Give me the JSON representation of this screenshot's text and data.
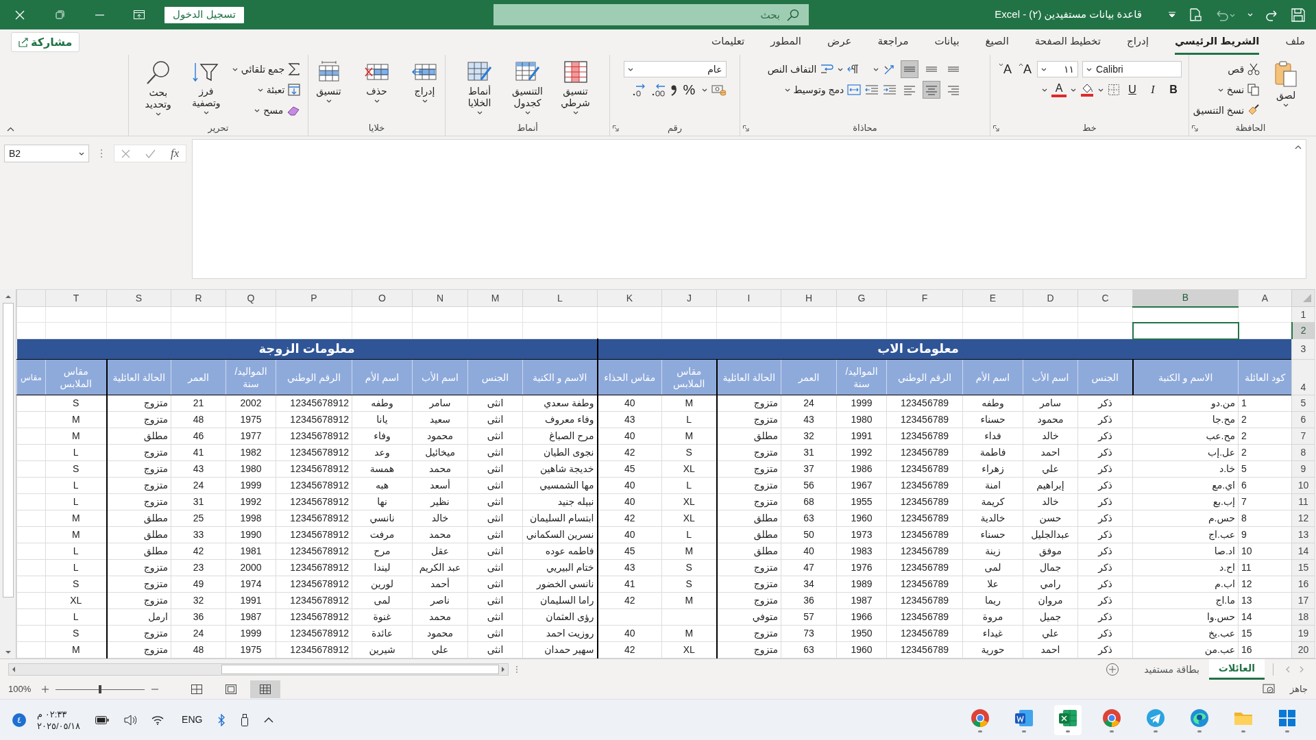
{
  "title_bar": {
    "title": "قاعدة بيانات مستفيدين (٢) - Excel",
    "search_placeholder": "بحث",
    "sign_in": "تسجيل الدخول"
  },
  "ribbon_tabs": [
    {
      "label": "ملف",
      "selected": false
    },
    {
      "label": "الشريط الرئيسي",
      "selected": true
    },
    {
      "label": "إدراج",
      "selected": false
    },
    {
      "label": "تخطيط الصفحة",
      "selected": false
    },
    {
      "label": "الصيغ",
      "selected": false
    },
    {
      "label": "بيانات",
      "selected": false
    },
    {
      "label": "مراجعة",
      "selected": false
    },
    {
      "label": "عرض",
      "selected": false
    },
    {
      "label": "المطور",
      "selected": false
    },
    {
      "label": "تعليمات",
      "selected": false
    }
  ],
  "share_button": "مشاركة",
  "ribbon_groups": [
    {
      "label": "الحافظة",
      "columns": [
        {
          "rows": [
            [
              {
                "kind": "paste",
                "label": "لصق"
              }
            ]
          ]
        },
        {
          "rows": [
            [
              {
                "kind": "cut",
                "label": "قص"
              }
            ],
            [
              {
                "kind": "copy",
                "label": "نسخ"
              }
            ],
            [
              {
                "kind": "painter",
                "label": "نسخ التنسيق"
              }
            ]
          ]
        }
      ]
    },
    {
      "label": "خط",
      "columns": [
        {
          "rows": [
            [
              {
                "kind": "font",
                "value": "Calibri"
              },
              {
                "kind": "size",
                "value": "١١"
              },
              {
                "kind": "grow",
                "label": "A"
              },
              {
                "kind": "shrink",
                "label": "A"
              }
            ],
            [
              {
                "kind": "bold",
                "label": "B"
              },
              {
                "kind": "italic",
                "label": "I"
              },
              {
                "kind": "underline",
                "label": "U"
              },
              {
                "kind": "borders"
              },
              {
                "kind": "fill"
              },
              {
                "kind": "fontcolor",
                "label": "A"
              }
            ]
          ]
        }
      ]
    },
    {
      "label": "محاذاة",
      "columns": [
        {
          "rows": [
            [
              {
                "kind": "valign",
                "selected": false
              },
              {
                "kind": "valign",
                "selected": false
              },
              {
                "kind": "valign",
                "selected": true
              },
              {
                "kind": "orientation"
              }
            ],
            [
              {
                "kind": "halign",
                "selected": false
              },
              {
                "kind": "halign",
                "selected": true
              },
              {
                "kind": "halign",
                "selected": false
              },
              {
                "kind": "indent"
              },
              {
                "kind": "outdent"
              }
            ]
          ]
        },
        {
          "rows": [
            [
              {
                "kind": "rtl"
              },
              {
                "kind": "wrap",
                "label": "التفاف النص"
              }
            ],
            [
              {
                "kind": "merge",
                "label": "دمج وتوسيط"
              }
            ]
          ]
        }
      ]
    },
    {
      "label": "رقم",
      "columns": [
        {
          "rows": [
            [
              {
                "kind": "format",
                "value": "عام"
              }
            ],
            [
              {
                "kind": "currency"
              },
              {
                "kind": "percent",
                "label": "%"
              },
              {
                "kind": "comma"
              },
              {
                "kind": "incdec"
              },
              {
                "kind": "decdec"
              }
            ]
          ]
        }
      ]
    },
    {
      "label": "أنماط",
      "columns": [
        {
          "rows": [
            [
              {
                "kind": "conditional",
                "label": "تنسيق شرطي"
              }
            ]
          ]
        },
        {
          "rows": [
            [
              {
                "kind": "astable",
                "label": "التنسيق كجدول"
              }
            ]
          ]
        },
        {
          "rows": [
            [
              {
                "kind": "styles",
                "label": "أنماط الخلايا"
              }
            ]
          ]
        }
      ]
    },
    {
      "label": "خلايا",
      "columns": [
        {
          "rows": [
            [
              {
                "kind": "insert",
                "label": "إدراج"
              }
            ]
          ]
        },
        {
          "rows": [
            [
              {
                "kind": "delete",
                "label": "حذف"
              }
            ]
          ]
        },
        {
          "rows": [
            [
              {
                "kind": "cellformat",
                "label": "تنسيق"
              }
            ]
          ]
        }
      ]
    },
    {
      "label": "تحرير",
      "columns": [
        {
          "rows": [
            [
              {
                "kind": "autosum",
                "label": "جمع تلقائي"
              }
            ],
            [
              {
                "kind": "filldown",
                "label": "تعبئة"
              }
            ],
            [
              {
                "kind": "clear",
                "label": "مسح"
              }
            ]
          ]
        },
        {
          "rows": [
            [
              {
                "kind": "sort",
                "label": "فرز وتصفية"
              }
            ]
          ]
        },
        {
          "rows": [
            [
              {
                "kind": "find",
                "label": "بحث وتحديد"
              }
            ]
          ]
        }
      ]
    }
  ],
  "formula_bar": {
    "name_box": "B2",
    "fx": "fx"
  },
  "sheet": {
    "column_headers": [
      {
        "label": "A",
        "selected": false
      },
      {
        "label": "B",
        "selected": true
      },
      {
        "label": "C",
        "selected": false
      },
      {
        "label": "D",
        "selected": false
      },
      {
        "label": "E",
        "selected": false
      },
      {
        "label": "F",
        "selected": false
      },
      {
        "label": "G",
        "selected": false
      },
      {
        "label": "H",
        "selected": false
      },
      {
        "label": "I",
        "selected": false
      },
      {
        "label": "J",
        "selected": false
      },
      {
        "label": "K",
        "selected": false
      },
      {
        "label": "L",
        "selected": false
      },
      {
        "label": "M",
        "selected": false
      },
      {
        "label": "N",
        "selected": false
      },
      {
        "label": "O",
        "selected": false
      },
      {
        "label": "P",
        "selected": false
      },
      {
        "label": "Q",
        "selected": false
      },
      {
        "label": "R",
        "selected": false
      },
      {
        "label": "S",
        "selected": false
      },
      {
        "label": "T",
        "selected": false
      }
    ],
    "row_numbers": [
      {
        "label": "1",
        "selected": false
      },
      {
        "label": "2",
        "selected": true
      },
      {
        "label": "3",
        "selected": false
      },
      {
        "label": "4",
        "selected": false
      },
      {
        "label": "5",
        "selected": false
      },
      {
        "label": "6",
        "selected": false
      },
      {
        "label": "7",
        "selected": false
      },
      {
        "label": "8",
        "selected": false
      },
      {
        "label": "9",
        "selected": false
      },
      {
        "label": "10",
        "selected": false
      },
      {
        "label": "11",
        "selected": false
      },
      {
        "label": "12",
        "selected": false
      },
      {
        "label": "13",
        "selected": false
      },
      {
        "label": "14",
        "selected": false
      },
      {
        "label": "15",
        "selected": false
      },
      {
        "label": "16",
        "selected": false
      },
      {
        "label": "17",
        "selected": false
      },
      {
        "label": "18",
        "selected": false
      },
      {
        "label": "19",
        "selected": false
      },
      {
        "label": "20",
        "selected": false
      }
    ],
    "section_titles": [
      "معلومات الاب",
      "معلومات الزوجة"
    ],
    "headers": [
      "كود العائلة",
      "الاسم و الكنية",
      "الجنس",
      "اسم الأب",
      "اسم الأم",
      "الرقم الوطني",
      "المواليد/ سنة",
      "العمر",
      "الحالة العائلية",
      "مقاس الملابس",
      "مقاس الحذاء",
      "الاسم و الكنية",
      "الجنس",
      "اسم الأب",
      "اسم الأم",
      "الرقم الوطني",
      "المواليد/ سنة",
      "العمر",
      "الحالة العائلية",
      "مقاس الملابس",
      "مقاس"
    ],
    "data": [
      [
        "1",
        "من.دو",
        "ذكر",
        "سامر",
        "وطفه",
        "123456789",
        "1999",
        "24",
        "متزوج",
        "M",
        "40",
        "وطفة سعدي",
        "انثى",
        "سامر",
        "وطفه",
        "12345678912",
        "2002",
        "21",
        "متزوج",
        "S"
      ],
      [
        "2",
        "مح.جا",
        "ذكر",
        "محمود",
        "حسناء",
        "123456789",
        "1980",
        "43",
        "متزوج",
        "L",
        "43",
        "وفاء معروف",
        "انثى",
        "سعيد",
        "يانا",
        "12345678912",
        "1975",
        "48",
        "متزوج",
        "M"
      ],
      [
        "2",
        "مح.عب",
        "ذكر",
        "خالد",
        "فداء",
        "123456789",
        "1991",
        "32",
        "مطلق",
        "M",
        "40",
        "مرح الصباغ",
        "انثى",
        "محمود",
        "وفاء",
        "12345678912",
        "1977",
        "46",
        "مطلق",
        "M"
      ],
      [
        "2",
        "عل.إب",
        "ذكر",
        "احمد",
        "فاطمة",
        "123456789",
        "1992",
        "31",
        "متزوج",
        "S",
        "42",
        "نجوى الطيان",
        "انثى",
        "ميخائيل",
        "وعد",
        "12345678912",
        "1982",
        "41",
        "متزوج",
        "L"
      ],
      [
        "5",
        "خا.د",
        "ذكر",
        "علي",
        "زهراء",
        "123456789",
        "1986",
        "37",
        "متزوج",
        "XL",
        "45",
        "خديجة شاهين",
        "انثى",
        "محمد",
        "همسة",
        "12345678912",
        "1980",
        "43",
        "متزوج",
        "S"
      ],
      [
        "6",
        "اي.مع",
        "ذكر",
        "إبراهيم",
        "امنة",
        "123456789",
        "1967",
        "56",
        "متزوج",
        "L",
        "40",
        "مها الشمسيي",
        "انثى",
        "أسعد",
        "هبه",
        "12345678912",
        "1999",
        "24",
        "متزوج",
        "L"
      ],
      [
        "7",
        "إب.بع",
        "ذكر",
        "خالد",
        "كريمة",
        "123456789",
        "1955",
        "68",
        "متزوج",
        "XL",
        "40",
        "نبيله جنيد",
        "انثى",
        "نظير",
        "نها",
        "12345678912",
        "1992",
        "31",
        "متزوج",
        "L"
      ],
      [
        "8",
        "حس.م",
        "ذكر",
        "حسن",
        "خالدية",
        "123456789",
        "1960",
        "63",
        "مطلق",
        "XL",
        "42",
        "ابتسام السليمان",
        "انثى",
        "خالد",
        "نانسي",
        "12345678912",
        "1998",
        "25",
        "مطلق",
        "M"
      ],
      [
        "9",
        "عب.اج",
        "ذكر",
        "عبدالجليل",
        "حسناء",
        "123456789",
        "1973",
        "50",
        "مطلق",
        "L",
        "40",
        "نسرين السكماني",
        "انثى",
        "محمد",
        "مرفت",
        "12345678912",
        "1990",
        "33",
        "مطلق",
        "M"
      ],
      [
        "10",
        "اد.صا",
        "ذكر",
        "موفق",
        "زينة",
        "123456789",
        "1983",
        "40",
        "مطلق",
        "M",
        "45",
        "فاطمه عوده",
        "انثى",
        "عقل",
        "مرح",
        "12345678912",
        "1981",
        "42",
        "مطلق",
        "L"
      ],
      [
        "11",
        "اح.د",
        "ذكر",
        "جمال",
        "لمى",
        "123456789",
        "1976",
        "47",
        "متزوج",
        "S",
        "43",
        "ختام البيريي",
        "انثى",
        "عبد الكريم",
        "ليندا",
        "12345678912",
        "2000",
        "23",
        "متزوج",
        "L"
      ],
      [
        "12",
        "اب.م",
        "ذكر",
        "رامي",
        "علا",
        "123456789",
        "1989",
        "34",
        "متزوج",
        "S",
        "41",
        "نانسي الخضور",
        "انثى",
        "أحمد",
        "لورين",
        "12345678912",
        "1974",
        "49",
        "متزوج",
        "S"
      ],
      [
        "13",
        "ما.اج",
        "ذكر",
        "مروان",
        "ريما",
        "123456789",
        "1987",
        "36",
        "متزوج",
        "M",
        "42",
        "راما السليمان",
        "انثى",
        "ناصر",
        "لمى",
        "12345678912",
        "1991",
        "32",
        "متزوج",
        "XL"
      ],
      {
        "father": [
          "14",
          "حس.وا",
          "ذكر",
          "جميل",
          "مروة",
          "123456789",
          "1966",
          "57",
          "متوفي"
        ],
        "wife": [
          "رؤى العثمان",
          "انثى",
          "محمد",
          "غنوة",
          "12345678912",
          "1987",
          "36",
          "ارمل",
          "L"
        ]
      },
      [
        "15",
        "عب.يخ",
        "ذكر",
        "علي",
        "غيداء",
        "123456789",
        "1950",
        "73",
        "متزوج",
        "M",
        "40",
        "روزيت احمد",
        "انثى",
        "محمود",
        "عائدة",
        "12345678912",
        "1999",
        "24",
        "متزوج",
        "S"
      ],
      [
        "16",
        "عب.من",
        "ذكر",
        "احمد",
        "حورية",
        "123456789",
        "1960",
        "63",
        "متزوج",
        "XL",
        "42",
        "سهير حمدان",
        "انثى",
        "علي",
        "شيرين",
        "12345678912",
        "1975",
        "48",
        "متزوج",
        "M"
      ]
    ]
  },
  "sheet_tabs": [
    {
      "label": "العائلات",
      "selected": true
    },
    {
      "label": "بطاقة مستفيد",
      "selected": false
    }
  ],
  "status_bar": {
    "status": "جاهز",
    "zoom": "100%",
    "zoom_level": {
      "level": 0.5
    }
  },
  "taskbar": {
    "time": "٠٢:٣٣ م",
    "date": "٢٠٢٥/٠٥/١٨",
    "language": "ENG",
    "notification_count": "٤"
  }
}
